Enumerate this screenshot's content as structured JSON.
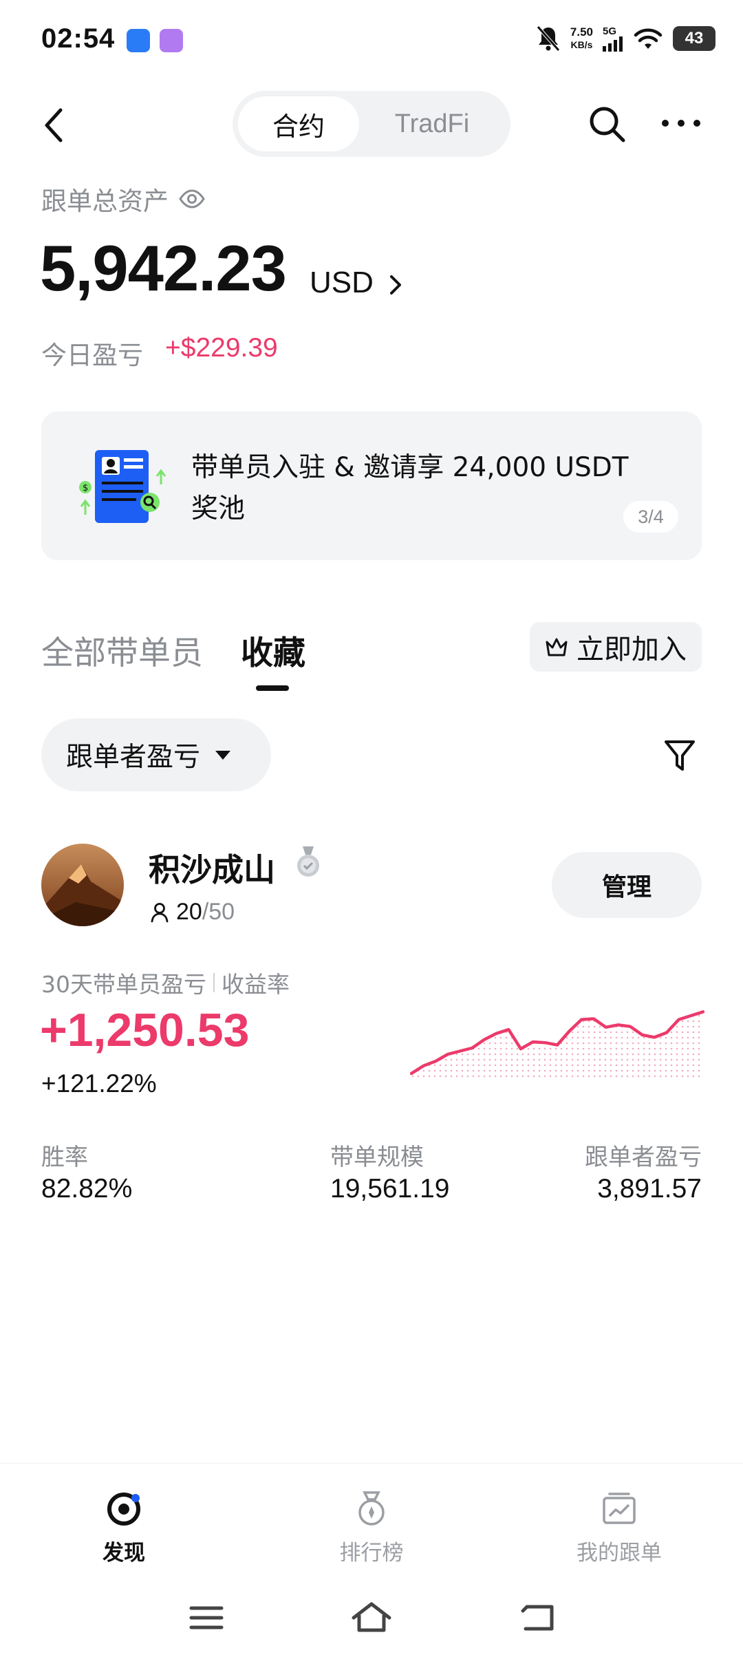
{
  "status_bar": {
    "time": "02:54",
    "net_speed_value": "7.50",
    "net_speed_unit": "KB/s",
    "signal_label": "5G",
    "battery": "43"
  },
  "header": {
    "segment_tabs": [
      "合约",
      "TradFi"
    ],
    "active_segment": "合约"
  },
  "assets": {
    "label": "跟单总资产",
    "total": "5,942.23",
    "currency": "USD",
    "today_pnl_label": "今日盈亏",
    "today_pnl_value": "+$229.39"
  },
  "banner": {
    "text": "带单员入驻 & 邀请享 24,000 USDT 奖池",
    "page_indicator": "3/4"
  },
  "tabs": {
    "all_traders": "全部带单员",
    "favorites": "收藏",
    "active": "收藏",
    "join_button": "立即加入"
  },
  "filter": {
    "sort_label": "跟单者盈亏"
  },
  "trader": {
    "name": "积沙成山",
    "followers_current": "20",
    "followers_max": "/50",
    "manage_button": "管理",
    "pnl_label": "30天带单员盈亏",
    "roi_label": "收益率",
    "pnl_value": "+1,250.53",
    "roi_value": "+121.22%",
    "stats": {
      "win_rate_label": "胜率",
      "win_rate_value": "82.82%",
      "aum_label": "带单规模",
      "aum_value": "19,561.19",
      "follower_pnl_label": "跟单者盈亏",
      "follower_pnl_value": "3,891.57"
    },
    "sparkline": [
      0.0,
      0.1,
      0.16,
      0.25,
      0.29,
      0.33,
      0.44,
      0.52,
      0.57,
      0.32,
      0.41,
      0.4,
      0.37,
      0.55,
      0.7,
      0.71,
      0.6,
      0.63,
      0.61,
      0.5,
      0.47,
      0.53,
      0.7,
      0.75,
      0.8
    ],
    "accent_color": "#ec3a6b"
  },
  "bottom_nav": {
    "items": [
      {
        "label": "发现",
        "icon": "discover-icon",
        "active": true
      },
      {
        "label": "排行榜",
        "icon": "medal-icon",
        "active": false
      },
      {
        "label": "我的跟单",
        "icon": "portfolio-icon",
        "active": false
      }
    ]
  }
}
